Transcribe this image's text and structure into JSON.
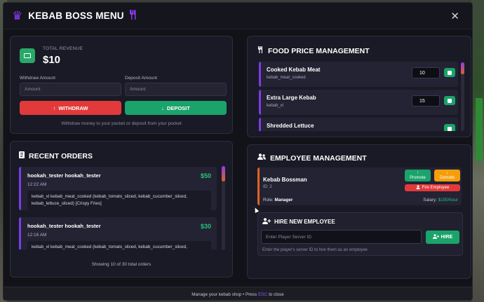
{
  "header": {
    "title": "KEBAB BOSS MENU",
    "crown_icon": "crown-icon",
    "utensils_icon": "utensils-icon",
    "close_label": "✕"
  },
  "revenue": {
    "label": "TOTAL REVENUE",
    "value": "$10",
    "withdraw_label": "Withdraw Amount",
    "withdraw_placeholder": "Amount",
    "deposit_label": "Deposit Amount",
    "deposit_placeholder": "Amount",
    "withdraw_button": "WITHDRAW",
    "deposit_button": "DEPOSIT",
    "hint": "Withdraw money to your pocket or deposit from your pocket"
  },
  "orders": {
    "title": "RECENT ORDERS",
    "items": [
      {
        "customer": "hookah_tester hookah_tester",
        "time": "12:22 AM",
        "price": "$50",
        "items": "kebab_xl kebab_meat_cooked (kebab_tomato_sliced, kebab_cucumber_sliced, kebab_lettuce_sliced) [Crispy Fries]"
      },
      {
        "customer": "hookah_tester hookah_tester",
        "time": "12:16 AM",
        "price": "$30",
        "items": "kebab_xl kebab_meat_cooked (kebab_tomato_sliced, kebab_cucumber_sliced,"
      }
    ],
    "footer": "Showing 10 of 30 total orders"
  },
  "food": {
    "title": "FOOD PRICE MANAGEMENT",
    "items": [
      {
        "name": "Cooked Kebab Meat",
        "id": "kebab_meat_cooked",
        "price": "10"
      },
      {
        "name": "Extra Large Kebab",
        "id": "kebab_xl",
        "price": "15"
      },
      {
        "name": "Shredded Lettuce",
        "id": "",
        "price": ""
      }
    ]
  },
  "employee": {
    "title": "EMPLOYEE MANAGEMENT",
    "card": {
      "name": "Kebab Bossman",
      "id": "ID: 2",
      "role_label": "Role:",
      "role": "Manager",
      "salary_label": "Salary:",
      "salary": "$150/hour",
      "promote": "Promote",
      "demote": "Demote",
      "fire": "Fire Employee"
    },
    "hire": {
      "title": "HIRE NEW EMPLOYEE",
      "placeholder": "Enter Player Server ID",
      "button": "HIRE",
      "hint": "Enter the player's server ID to hire them as an employee"
    }
  },
  "footer": {
    "text_before": "Manage your kebab shop • Press",
    "key": "ESC",
    "text_after": "to close"
  },
  "colors": {
    "accent": "#8b3bf5",
    "green": "#1aa36b",
    "red": "#e23a3a",
    "orange": "#f59e0b"
  }
}
